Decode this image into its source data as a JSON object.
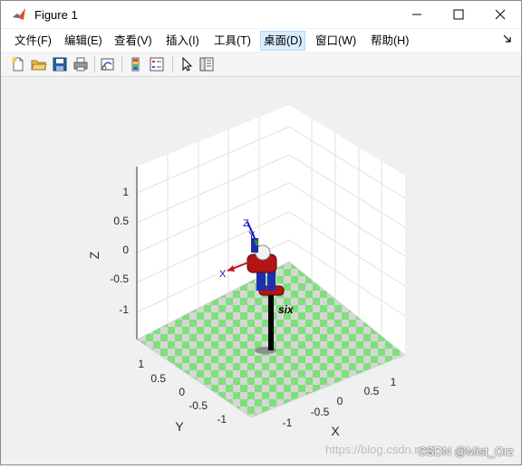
{
  "window": {
    "title": "Figure 1",
    "app_icon": "matlab-icon",
    "controls": [
      "minimize-icon",
      "maximize-icon",
      "close-icon"
    ]
  },
  "menubar": {
    "items": [
      {
        "label": "文件(F)"
      },
      {
        "label": "编辑(E)"
      },
      {
        "label": "查看(V)"
      },
      {
        "label": "插入(I)"
      },
      {
        "label": "工具(T)"
      },
      {
        "label": "桌面(D)",
        "active": true
      },
      {
        "label": "窗口(W)"
      },
      {
        "label": "帮助(H)"
      }
    ],
    "dock_icon": "dock-arrow-icon"
  },
  "toolbar": {
    "buttons": [
      "new-figure-icon",
      "open-file-icon",
      "save-icon",
      "print-icon",
      "link-plot-icon",
      "colorbar-icon",
      "legend-icon",
      "pointer-icon",
      "property-inspector-icon"
    ]
  },
  "plot": {
    "xlabel": "X",
    "ylabel": "Y",
    "zlabel": "Z",
    "z_ticks": [
      "1",
      "0.5",
      "0",
      "-0.5",
      "-1"
    ],
    "y_ticks": [
      "1",
      "0.5",
      "0",
      "-0.5",
      "-1"
    ],
    "x_ticks": [
      "-1",
      "-0.5",
      "0",
      "0.5",
      "1"
    ],
    "robot_label": "six",
    "frame_axis_z": "Z",
    "frame_axis_y": "Y",
    "frame_axis_x": "X",
    "floor_colors": [
      "#7ee07a",
      "#d6d6d6"
    ]
  },
  "overlay": {
    "watermark": "https://blog.csdn.net/",
    "credit": "CSDN @Mist_Orz"
  }
}
